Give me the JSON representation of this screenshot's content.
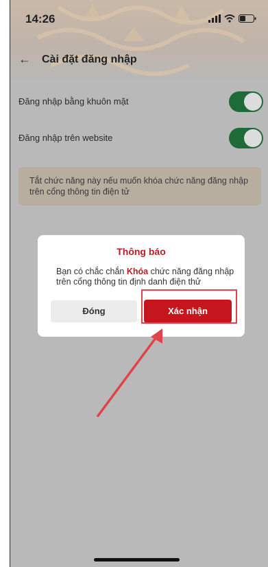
{
  "status_bar": {
    "time": "14:26",
    "icons": [
      "signal-icon",
      "wifi-icon",
      "battery-icon"
    ]
  },
  "nav": {
    "back_icon": "←",
    "title": "Cài đặt đăng nhập"
  },
  "settings": [
    {
      "label": "Đăng nhập bằng khuôn mặt",
      "enabled": true
    },
    {
      "label": "Đăng nhập trên website",
      "enabled": true
    }
  ],
  "note": "Tắt chức năng này nếu muốn khóa chức năng đăng nhập trên cổng thông tin điện tử",
  "dialog": {
    "title": "Thông báo",
    "body_pre": "Bạn có chắc chắn ",
    "body_emphasis": "Khóa",
    "body_post": " chức năng đăng nhập trên cổng thông tin định danh điện thử",
    "close_label": "Đóng",
    "confirm_label": "Xác nhận"
  },
  "colors": {
    "accent": "#c4161c",
    "toggle_on": "#1f6b37",
    "annotation": "#e0434a"
  }
}
